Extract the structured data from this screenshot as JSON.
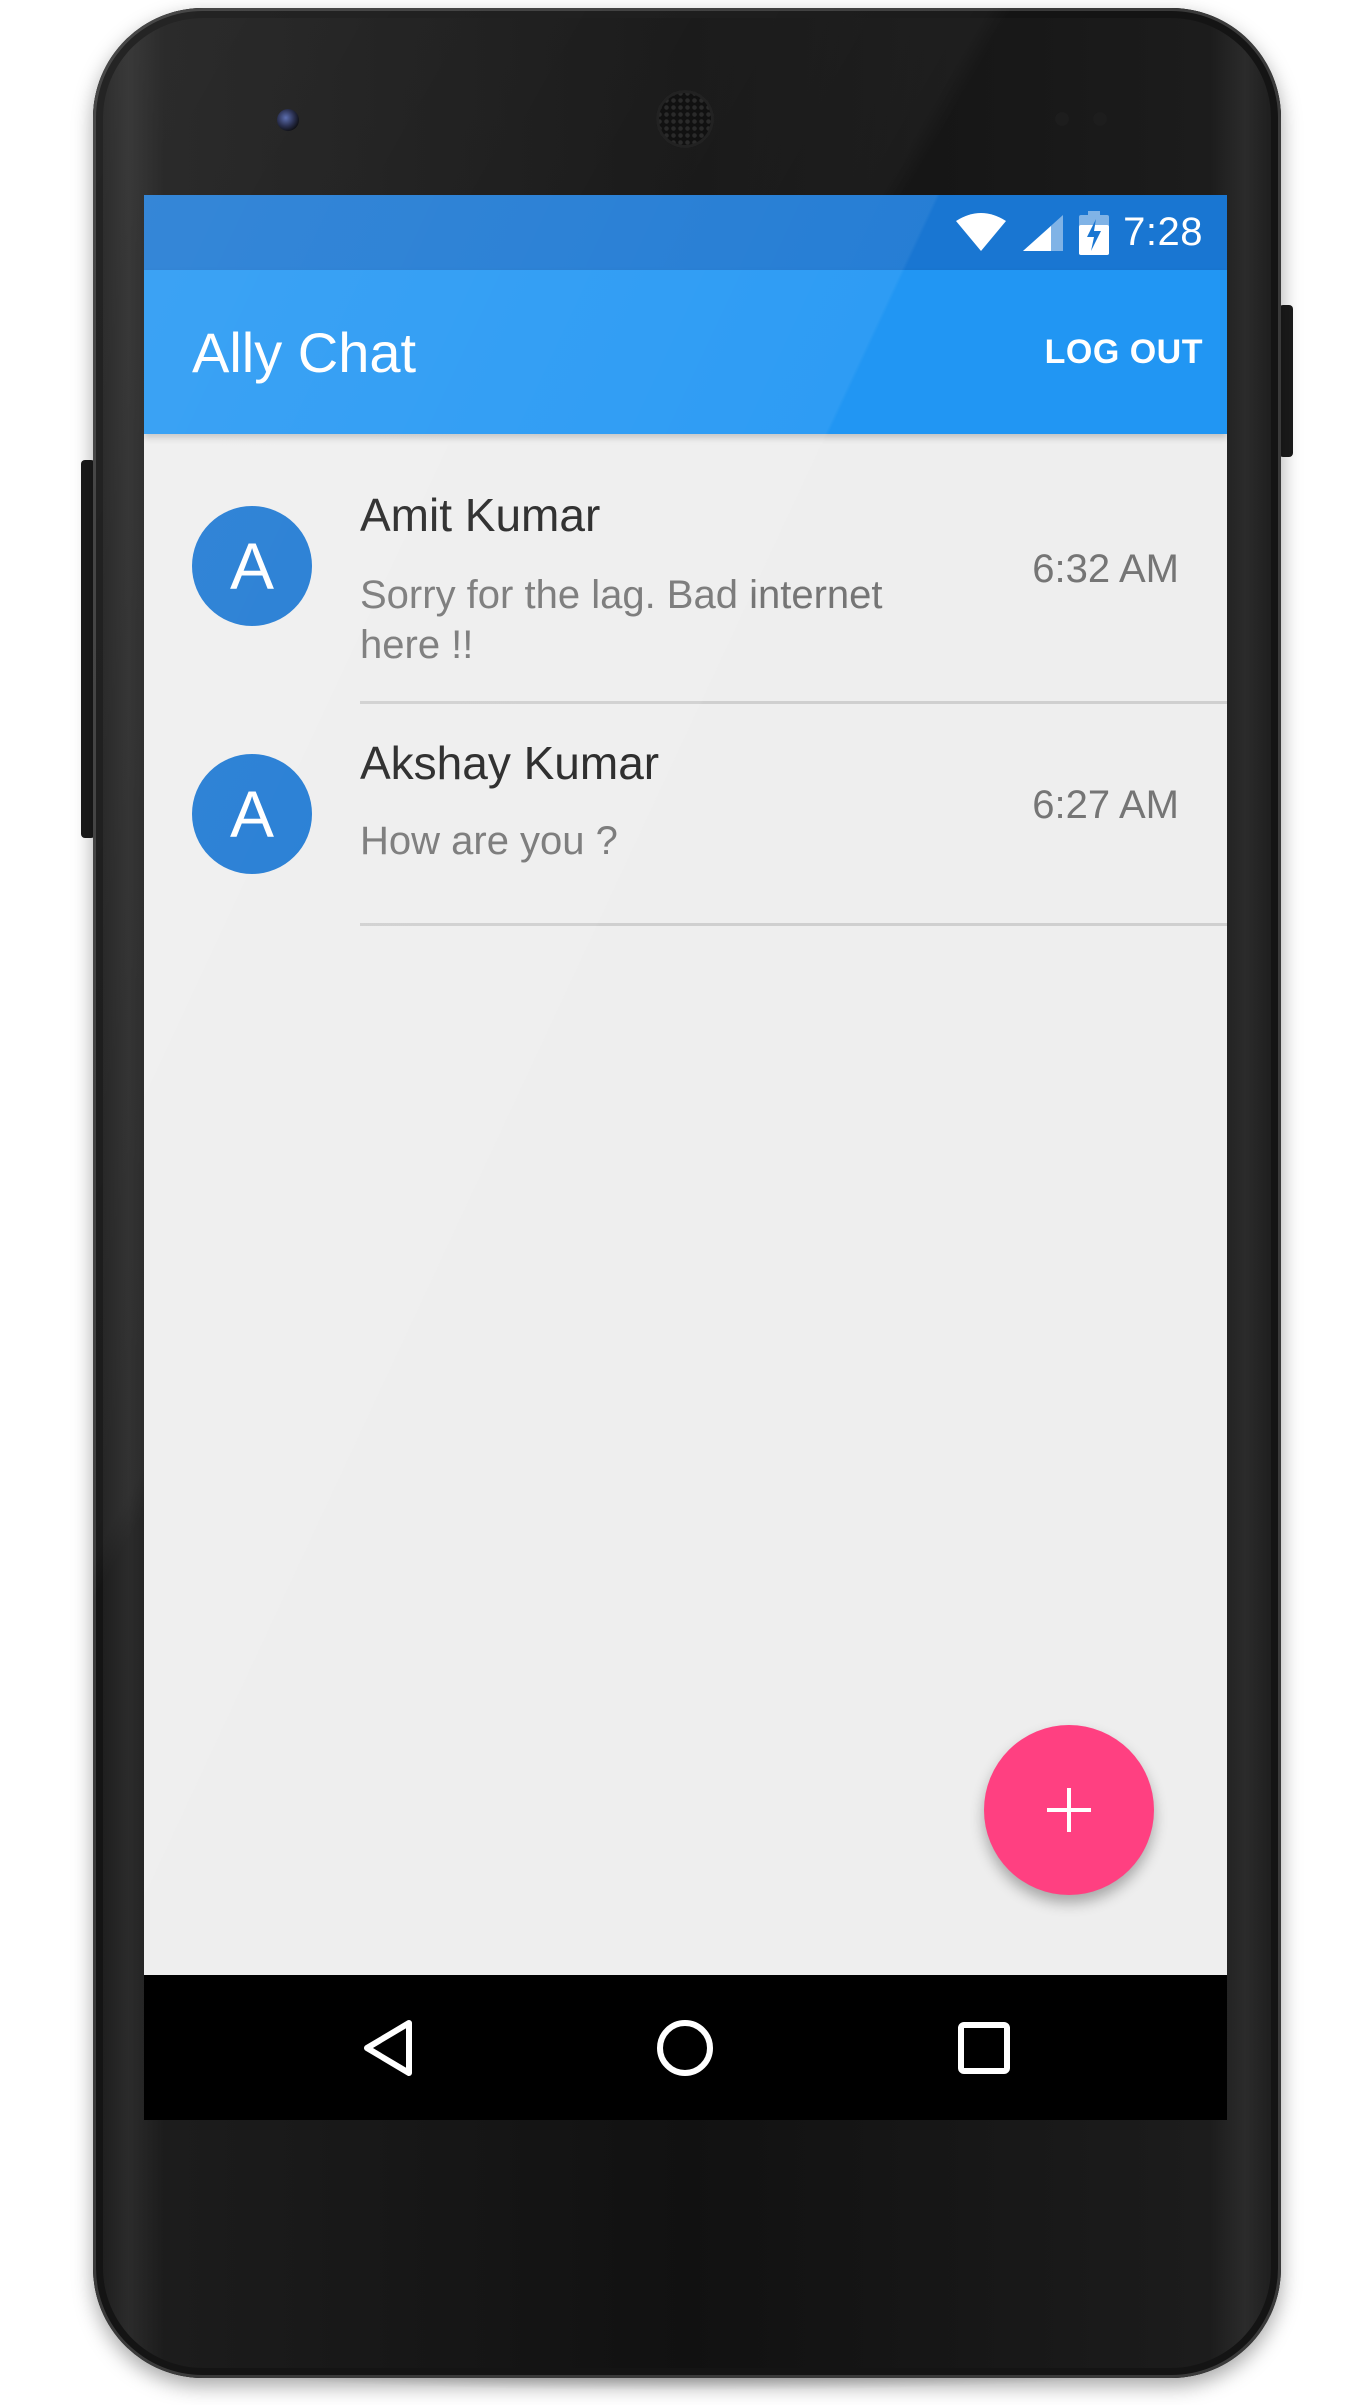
{
  "status_bar": {
    "time": "7:28",
    "icons": [
      "wifi-icon",
      "signal-icon",
      "battery-charging-icon"
    ]
  },
  "app_bar": {
    "title": "Ally Chat",
    "logout_label": "LOG OUT"
  },
  "chats": [
    {
      "avatar_letter": "A",
      "name": "Amit Kumar",
      "last_message": "Sorry for the lag. Bad internet here !!",
      "time": "6:32 AM"
    },
    {
      "avatar_letter": "A",
      "name": "Akshay Kumar",
      "last_message": "How are you ?",
      "time": "6:27 AM"
    }
  ],
  "fab": {
    "icon": "plus-icon"
  },
  "nav_bar": {
    "icons": [
      "back-icon",
      "home-icon",
      "recents-icon"
    ]
  },
  "colors": {
    "status_bar": "#1976d2",
    "app_bar": "#2196f3",
    "avatar": "#1976d2",
    "fab": "#ff4081",
    "list_background": "#eeeeee"
  }
}
